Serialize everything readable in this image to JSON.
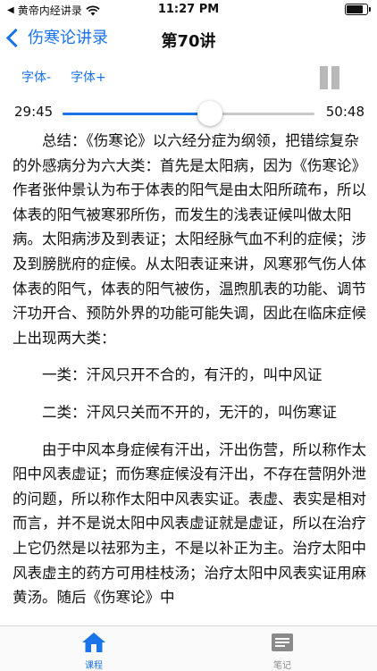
{
  "status_bar": {
    "back_app": "黄帝内经讲录",
    "time": "11:27 PM",
    "battery_level": 0.82
  },
  "nav": {
    "back_label": "伤寒论讲录",
    "title": "第70讲"
  },
  "controls": {
    "font_decrease": "字体-",
    "font_increase": "字体+"
  },
  "player": {
    "current_time": "29:45",
    "total_time": "50:48",
    "progress": 0.5856
  },
  "content": {
    "paragraphs": [
      "总结：《伤寒论》以六经分症为纲领，把错综复杂的外感病分为六大类：首先是太阳病，因为《伤寒论》作者张仲景认为布于体表的阳气是由太阳所疏布，所以体表的阳气被寒邪所伤，而发生的浅表证候叫做太阳病。太阳病涉及到表证；太阳经脉气血不利的症候；涉及到膀胱府的症候。从太阳表证来讲，风寒邪气伤人体体表的阳气，体表的阳气被伤，温煦肌表的功能、调节汗功开合、预防外界的功能可能失调，因此在临床症候上出现两大类：",
      "一类：汗风只开不合的，有汗的，叫中风证",
      "二类：汗风只关而不开的，无汗的，叫伤寒证",
      "由于中风本身症候有汗出，汗出伤营，所以称作太阳中风表虚证；而伤寒症候没有汗出，不存在营阴外泄的问题，所以称作太阳中风表实证。表虚、表实是相对而言，并不是说太阳中风表虚证就是虚证，所以在治疗上它仍然是以祛邪为主，不是以补正为主。治疗太阳中风表虚主的药方可用桂枝汤；治疗太阳中风表实证用麻黄汤。随后《伤寒论》中"
    ]
  },
  "tabbar": {
    "course_label": "课程",
    "notes_label": "笔记"
  },
  "colors": {
    "accent": "#1a73e8",
    "inactive": "#8a8a8a",
    "pause_gray": "#b8b8b8"
  }
}
